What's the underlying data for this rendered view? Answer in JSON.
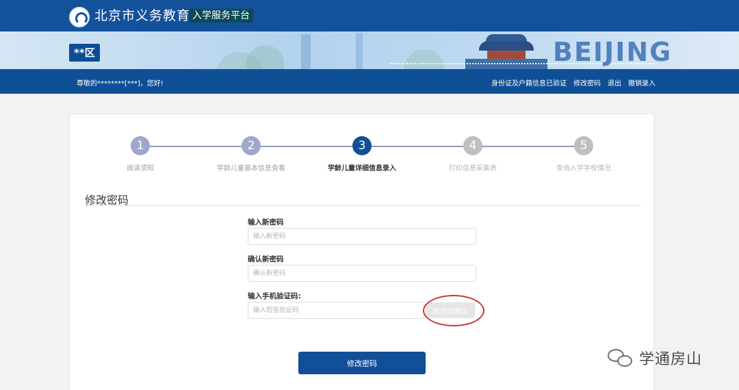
{
  "header": {
    "site_title": "北京市义务教育",
    "site_badge": "入学服务平台",
    "district": "**区",
    "banner_text": "BEIJING"
  },
  "nav": {
    "greeting": "尊敬的********[***]，您好!",
    "links": [
      "身份证及户籍信息已验证",
      "修改密码",
      "退出",
      "撤销录入"
    ]
  },
  "steps": [
    {
      "num": "1",
      "label": "阅读须知",
      "state": "done"
    },
    {
      "num": "2",
      "label": "学龄儿童基本信息查看",
      "state": "done"
    },
    {
      "num": "3",
      "label": "学龄儿童详细信息录入",
      "state": "active"
    },
    {
      "num": "4",
      "label": "打印信息采集表",
      "state": "future"
    },
    {
      "num": "5",
      "label": "查询入学学校情况",
      "state": "future"
    }
  ],
  "form": {
    "section_title": "修改密码",
    "new_password": {
      "label": "输入新密码",
      "placeholder": "输入新密码",
      "value": ""
    },
    "confirm_password": {
      "label": "确认新密码",
      "placeholder": "确认新密码",
      "value": ""
    },
    "sms_code": {
      "label": "输入手机验证码:",
      "placeholder": "输入短信验证码",
      "value": "",
      "button_label": "50秒后重试"
    },
    "submit_label": "修改密码"
  },
  "watermark": {
    "text": "学通房山"
  },
  "colors": {
    "primary": "#114f97",
    "accent_mark": "#c7392d",
    "step_done": "#9ea7cc",
    "step_future": "#bfbfbf"
  }
}
